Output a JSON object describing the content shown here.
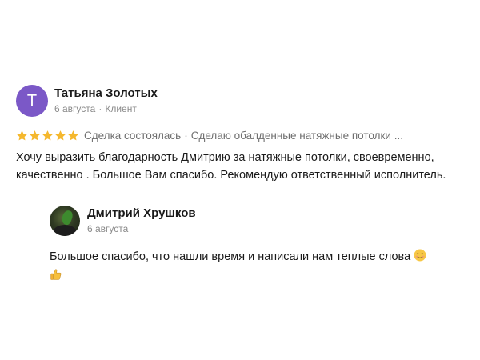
{
  "review": {
    "author_initial": "Т",
    "author_name": "Татьяна Золотых",
    "date": "6 августа",
    "meta_sep": "·",
    "role": "Клиент",
    "stars": 5,
    "deal_status": "Сделка состоялась",
    "deal_sep": "·",
    "service": "Сделаю обалденные натяжные потолки ...",
    "text": "Хочу выразить благодарность Дмитрию за натяжные потолки, своевременно, качественно . Большое Вам спасибо. Рекомендую ответственный исполнитель.",
    "avatar_color": "#7b58c7",
    "star_color": "#f5b82e"
  },
  "reply": {
    "author_name": "Дмитрий Хрушков",
    "date": "6 августа",
    "text": "Большое спасибо, что нашли время и написали нам теплые слова",
    "emojis": [
      "smiling-face-icon",
      "thumbs-up-icon"
    ]
  }
}
